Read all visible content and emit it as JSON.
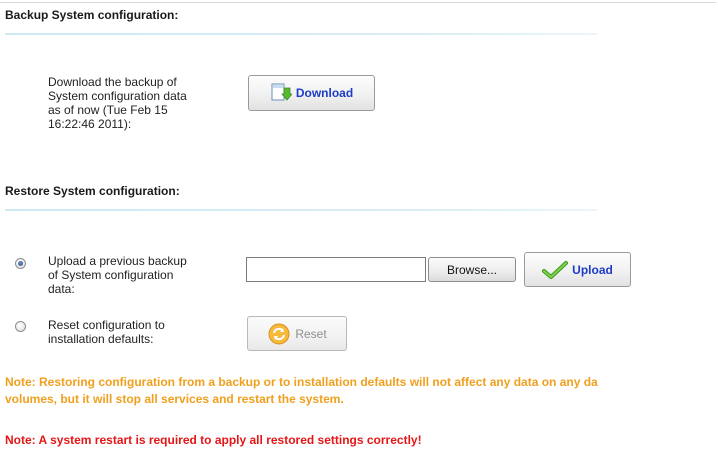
{
  "backup": {
    "title": "Backup System configuration:",
    "description_lines": [
      "Download the backup of",
      "System configuration data",
      "as of now (Tue Feb 15",
      "16:22:46 2011):"
    ],
    "download_label": "Download"
  },
  "restore": {
    "title": "Restore System configuration:",
    "upload_option": {
      "label_lines": [
        "Upload a previous backup",
        "of System configuration",
        "data:"
      ],
      "selected": true
    },
    "file_input_value": "",
    "browse_label": "Browse...",
    "upload_label": "Upload",
    "reset_option": {
      "label_lines": [
        "Reset configuration to",
        "installation defaults:"
      ],
      "selected": false
    },
    "reset_label": "Reset"
  },
  "notes": {
    "orange_line1": "Note: Restoring configuration from a backup or to installation defaults will not affect any data on any da",
    "orange_line2": "volumes, but it will stop all services and restart the system.",
    "red": "Note: A system restart is required to apply all restored settings correctly!"
  },
  "colors": {
    "button_text": "#1d3cc8",
    "note_orange": "#f0a01e",
    "note_red": "#e41616",
    "section_rule": "#cfe9f3"
  },
  "icons": {
    "download": "download-icon",
    "upload": "checkmark-icon",
    "reset": "refresh-icon"
  }
}
